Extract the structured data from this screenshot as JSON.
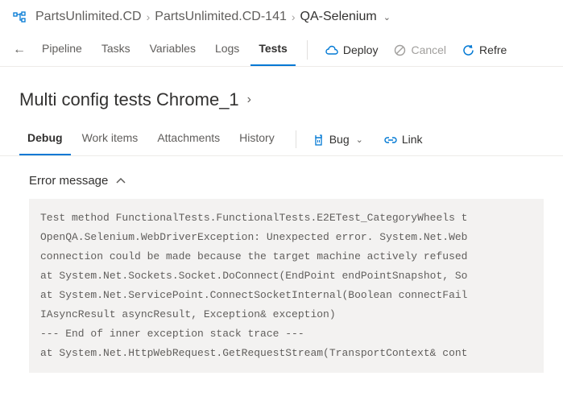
{
  "breadcrumb": {
    "root": "PartsUnlimited.CD",
    "release": "PartsUnlimited.CD-141",
    "stage": "QA-Selenium"
  },
  "pivots": {
    "pipeline": "Pipeline",
    "tasks": "Tasks",
    "variables": "Variables",
    "logs": "Logs",
    "tests": "Tests"
  },
  "toolbar": {
    "deploy": "Deploy",
    "cancel": "Cancel",
    "refresh": "Refre"
  },
  "page": {
    "title": "Multi config tests Chrome_1"
  },
  "subtabs": {
    "debug": "Debug",
    "work_items": "Work items",
    "attachments": "Attachments",
    "history": "History"
  },
  "actions": {
    "bug": "Bug",
    "link": "Link"
  },
  "section": {
    "error_header": "Error message"
  },
  "error": {
    "lines": [
      "Test method FunctionalTests.FunctionalTests.E2ETest_CategoryWheels t",
      "OpenQA.Selenium.WebDriverException: Unexpected error. System.Net.Web",
      "connection could be made because the target machine actively refused",
      "at System.Net.Sockets.Socket.DoConnect(EndPoint endPointSnapshot, So",
      "at System.Net.ServicePoint.ConnectSocketInternal(Boolean connectFail",
      "IAsyncResult asyncResult, Exception& exception)",
      "--- End of inner exception stack trace ---",
      "at System.Net.HttpWebRequest.GetRequestStream(TransportContext& cont"
    ]
  }
}
